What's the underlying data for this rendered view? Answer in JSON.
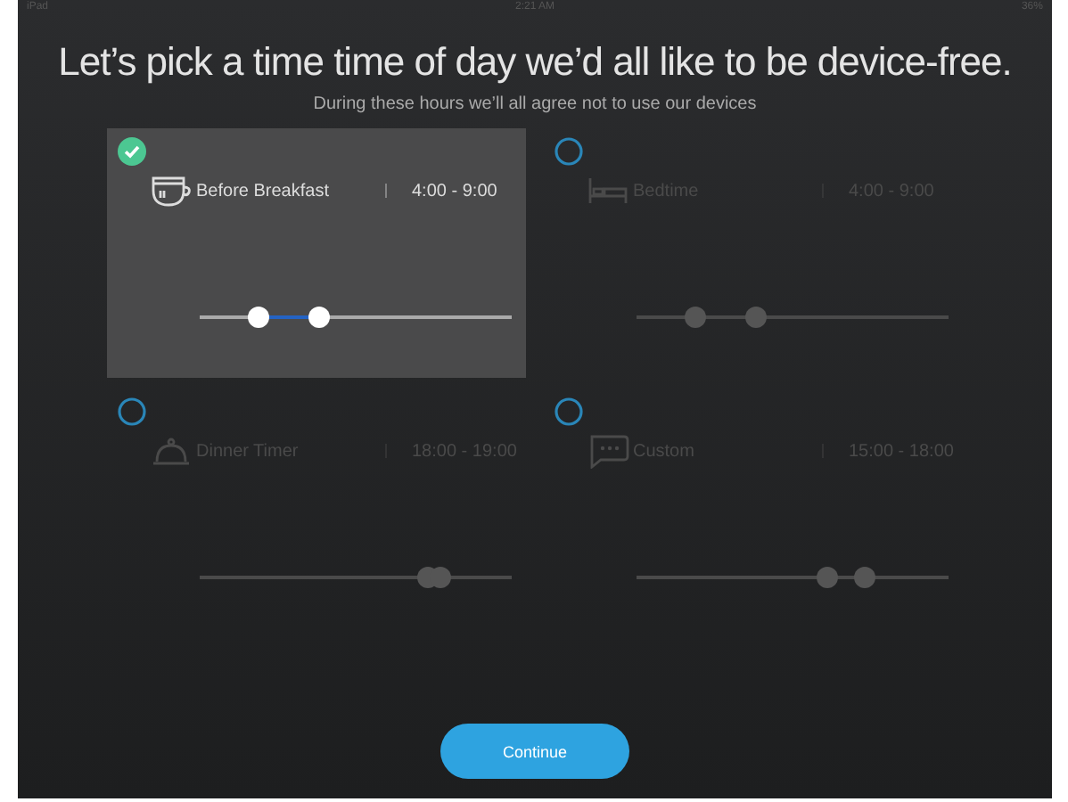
{
  "status_bar": {
    "device": "iPad",
    "time": "2:21 AM",
    "battery": "36%"
  },
  "title": "Let’s pick a time time of day we’d all like to be device-free.",
  "subtitle": "During these hours we’ll all agree not to use our devices",
  "options": [
    {
      "kind": "cup",
      "label": "Before Breakfast",
      "time": "4:00 - 9:00",
      "selected": true,
      "thumbs": [
        {
          "level": 0.19
        },
        {
          "level": 0.38
        }
      ]
    },
    {
      "kind": "bed",
      "label": "Bedtime",
      "time": "4:00 - 9:00",
      "selected": false,
      "thumbs": [
        {
          "level": 0.19
        },
        {
          "level": 0.38
        }
      ]
    },
    {
      "kind": "cloche",
      "label": "Dinner Timer",
      "time": "18:00 - 19:00",
      "selected": false,
      "thumbs": [
        {
          "level": 0.73
        },
        {
          "level": 0.77
        }
      ]
    },
    {
      "kind": "chat",
      "label": "Custom",
      "time": "15:00 - 18:00",
      "selected": false,
      "thumbs": [
        {
          "level": 0.61
        },
        {
          "level": 0.73
        }
      ]
    }
  ],
  "continue_button": "Continue"
}
